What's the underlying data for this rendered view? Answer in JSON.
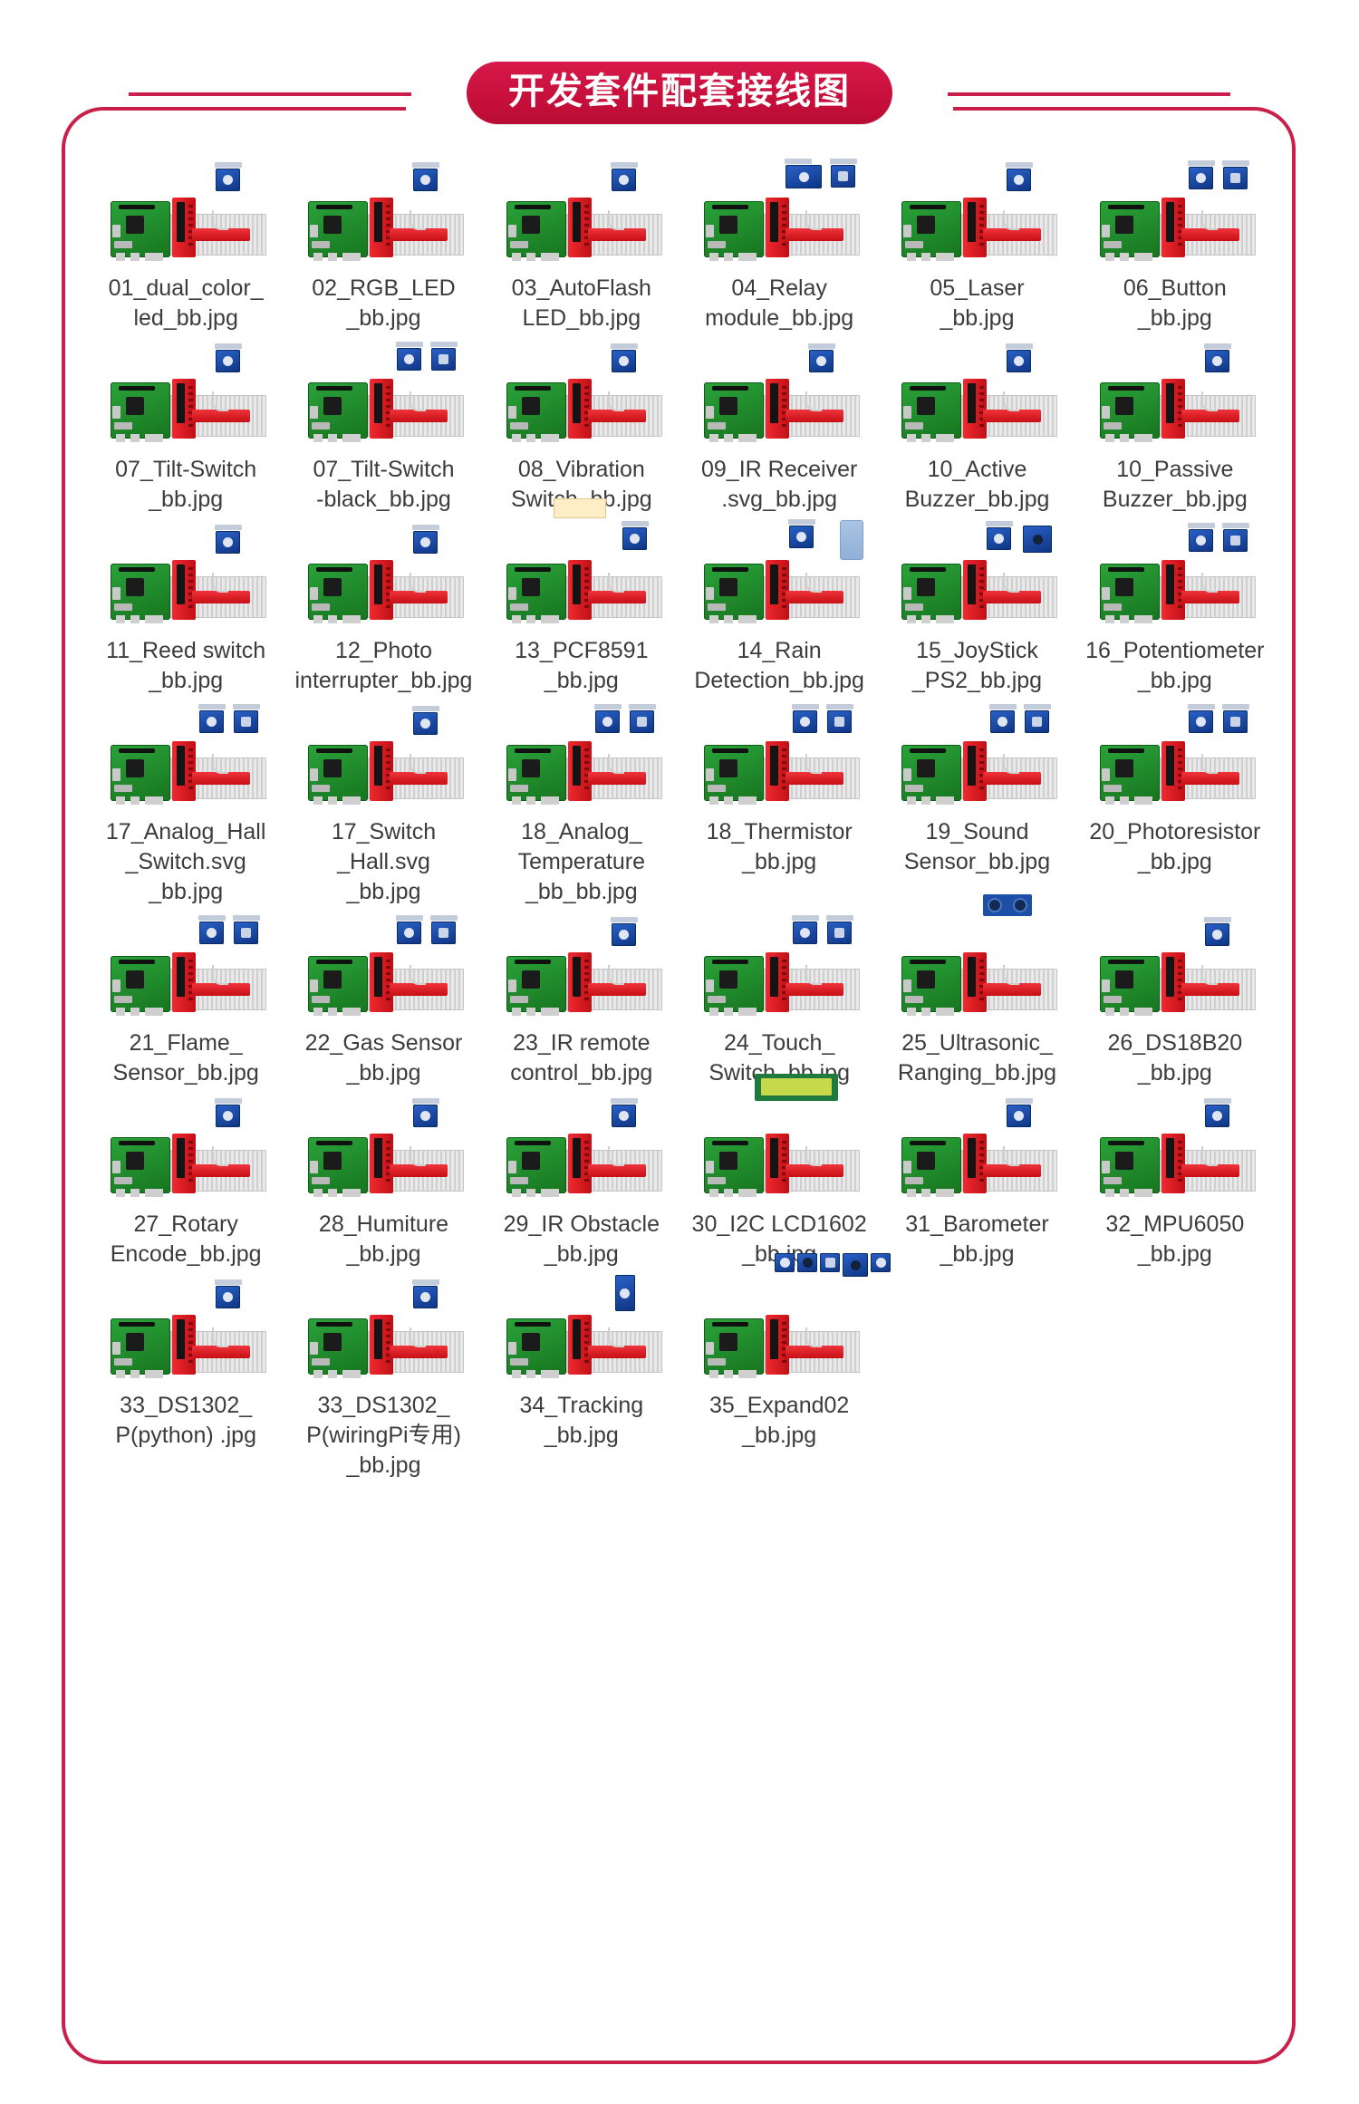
{
  "header": {
    "title": "开发套件配套接线图",
    "pill_color": "#c8103c",
    "rule_color": "#c8204b"
  },
  "frame": {
    "border_color": "#c8204b"
  },
  "grid": {
    "columns": 6,
    "item_count": 40,
    "items": [
      {
        "index": "01",
        "label": "01_dual_color_\nled_bb.jpg",
        "thumb": "pi-cobbler-breadboard-module"
      },
      {
        "index": "02",
        "label": "02_RGB_LED\n_bb.jpg",
        "thumb": "pi-cobbler-breadboard-module"
      },
      {
        "index": "03",
        "label": "03_AutoFlash\nLED_bb.jpg",
        "thumb": "pi-cobbler-breadboard-module"
      },
      {
        "index": "04",
        "label": "04_Relay\nmodule_bb.jpg",
        "thumb": "pi-cobbler-breadboard-relay-two-modules"
      },
      {
        "index": "05",
        "label": "05_Laser\n_bb.jpg",
        "thumb": "pi-cobbler-breadboard-module"
      },
      {
        "index": "06",
        "label": "06_Button\n_bb.jpg",
        "thumb": "pi-cobbler-breadboard-two-modules"
      },
      {
        "index": "07",
        "label": "07_Tilt-Switch\n_bb.jpg",
        "thumb": "pi-cobbler-breadboard-module"
      },
      {
        "index": "07b",
        "label": "07_Tilt-Switch\n-black_bb.jpg",
        "thumb": "pi-cobbler-breadboard-two-modules"
      },
      {
        "index": "08",
        "label": "08_Vibration\nSwitch_bb.jpg",
        "thumb": "pi-cobbler-breadboard-module"
      },
      {
        "index": "09",
        "label": "09_IR Receiver\n.svg_bb.jpg",
        "thumb": "pi-cobbler-breadboard-module"
      },
      {
        "index": "10a",
        "label": "10_Active\nBuzzer_bb.jpg",
        "thumb": "pi-cobbler-breadboard-module"
      },
      {
        "index": "10b",
        "label": "10_Passive\nBuzzer_bb.jpg",
        "thumb": "pi-cobbler-breadboard-module"
      },
      {
        "index": "11",
        "label": "11_Reed switch\n_bb.jpg",
        "thumb": "pi-cobbler-breadboard-module"
      },
      {
        "index": "12",
        "label": "12_Photo\ninterrupter_bb.jpg",
        "thumb": "pi-cobbler-breadboard-module"
      },
      {
        "index": "13",
        "label": "13_PCF8591\n_bb.jpg",
        "thumb": "pi-cobbler-breadboard-note-module"
      },
      {
        "index": "14",
        "label": "14_Rain\nDetection_bb.jpg",
        "thumb": "pi-cobbler-breadboard-rainplate"
      },
      {
        "index": "15",
        "label": "15_JoyStick\n_PS2_bb.jpg",
        "thumb": "pi-cobbler-breadboard-joystick"
      },
      {
        "index": "16",
        "label": "16_Potentiometer\n_bb.jpg",
        "thumb": "pi-cobbler-breadboard-two-modules"
      },
      {
        "index": "17a",
        "label": "17_Analog_Hall\n_Switch.svg\n_bb.jpg",
        "thumb": "pi-cobbler-breadboard-two-modules"
      },
      {
        "index": "17b",
        "label": "17_Switch\n_Hall.svg\n_bb.jpg",
        "thumb": "pi-cobbler-breadboard-module"
      },
      {
        "index": "18a",
        "label": "18_Analog_\nTemperature\n_bb_bb.jpg",
        "thumb": "pi-cobbler-breadboard-two-modules"
      },
      {
        "index": "18b",
        "label": "18_Thermistor\n_bb.jpg",
        "thumb": "pi-cobbler-breadboard-two-modules"
      },
      {
        "index": "19",
        "label": "19_Sound\nSensor_bb.jpg",
        "thumb": "pi-cobbler-breadboard-two-modules"
      },
      {
        "index": "20",
        "label": "20_Photoresistor\n_bb.jpg",
        "thumb": "pi-cobbler-breadboard-two-modules"
      },
      {
        "index": "21",
        "label": "21_Flame_\nSensor_bb.jpg",
        "thumb": "pi-cobbler-breadboard-two-modules"
      },
      {
        "index": "22",
        "label": "22_Gas Sensor\n_bb.jpg",
        "thumb": "pi-cobbler-breadboard-two-modules"
      },
      {
        "index": "23",
        "label": "23_IR remote\ncontrol_bb.jpg",
        "thumb": "pi-cobbler-breadboard-module"
      },
      {
        "index": "24",
        "label": "24_Touch_\nSwitch_bb.jpg",
        "thumb": "pi-cobbler-breadboard-two-modules"
      },
      {
        "index": "25",
        "label": "25_Ultrasonic_\nRanging_bb.jpg",
        "thumb": "pi-cobbler-breadboard-ultrasonic"
      },
      {
        "index": "26",
        "label": "26_DS18B20\n_bb.jpg",
        "thumb": "pi-cobbler-breadboard-module"
      },
      {
        "index": "27",
        "label": "27_Rotary\nEncode_bb.jpg",
        "thumb": "pi-cobbler-breadboard-module"
      },
      {
        "index": "28",
        "label": "28_Humiture\n_bb.jpg",
        "thumb": "pi-cobbler-breadboard-module"
      },
      {
        "index": "29",
        "label": "29_IR Obstacle\n_bb.jpg",
        "thumb": "pi-cobbler-breadboard-module"
      },
      {
        "index": "30",
        "label": "30_I2C LCD1602\n_bb.jpg",
        "thumb": "pi-cobbler-breadboard-lcd"
      },
      {
        "index": "31",
        "label": "31_Barometer\n_bb.jpg",
        "thumb": "pi-cobbler-breadboard-module"
      },
      {
        "index": "32",
        "label": "32_MPU6050\n_bb.jpg",
        "thumb": "pi-cobbler-breadboard-module"
      },
      {
        "index": "33a",
        "label": "33_DS1302_\nP(python) .jpg",
        "thumb": "pi-cobbler-breadboard-module"
      },
      {
        "index": "33b",
        "label": "33_DS1302_\nP(wiringPi专用)\n_bb.jpg",
        "thumb": "pi-cobbler-breadboard-module"
      },
      {
        "index": "34",
        "label": "34_Tracking\n_bb.jpg",
        "thumb": "pi-cobbler-breadboard-tall-module"
      },
      {
        "index": "35",
        "label": "35_Expand02\n_bb.jpg",
        "thumb": "pi-cobbler-breadboard-many-modules"
      }
    ]
  }
}
